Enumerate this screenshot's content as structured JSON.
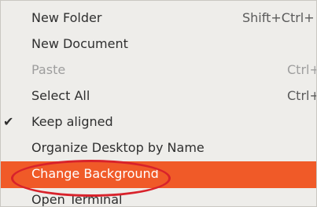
{
  "menu": {
    "items": [
      {
        "label": "New Folder",
        "shortcut": "Shift+Ctrl+",
        "checked": false,
        "disabled": false
      },
      {
        "label": "New Document",
        "shortcut": "",
        "checked": false,
        "disabled": false
      },
      {
        "label": "Paste",
        "shortcut": "Ctrl+",
        "checked": false,
        "disabled": true
      },
      {
        "label": "Select All",
        "shortcut": "Ctrl+",
        "checked": false,
        "disabled": false
      },
      {
        "label": "Keep aligned",
        "shortcut": "",
        "checked": true,
        "disabled": false
      },
      {
        "label": "Organize Desktop by Name",
        "shortcut": "",
        "checked": false,
        "disabled": false
      },
      {
        "label": "Change Background",
        "shortcut": "",
        "checked": false,
        "disabled": false,
        "highlighted": true
      },
      {
        "label": "Open Terminal",
        "shortcut": "",
        "checked": false,
        "disabled": false
      }
    ],
    "check_glyph": "✔"
  },
  "colors": {
    "menu_background": "#eeedea",
    "highlight": "#f05a28",
    "annotation": "#d8222b"
  }
}
